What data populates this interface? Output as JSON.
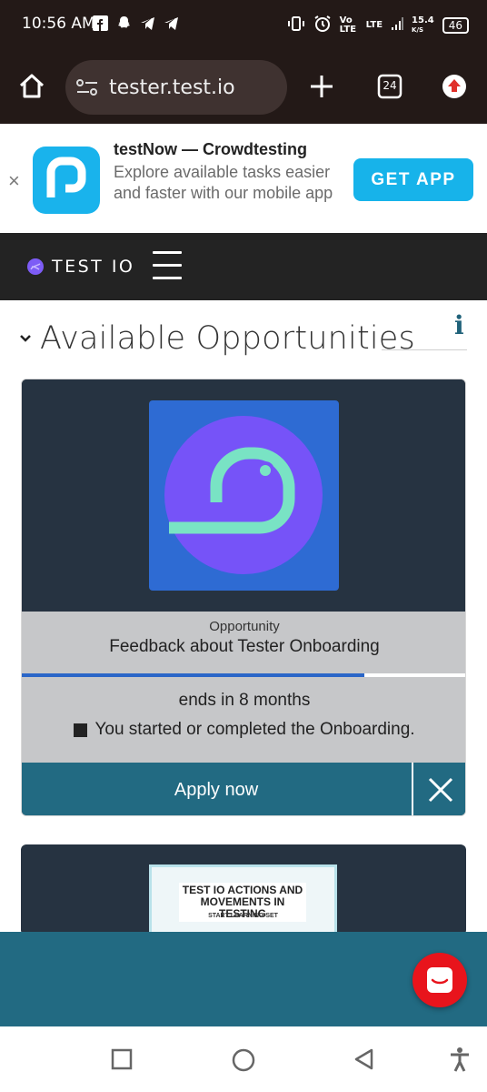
{
  "status_bar": {
    "time": "10:56 AM",
    "network": "Vo LTE",
    "lte": "LTE",
    "speed": "15.4",
    "speed_unit": "K/S",
    "battery": "46"
  },
  "browser": {
    "url": "tester.test.io",
    "tab_count": "24"
  },
  "app_banner": {
    "title": "testNow — Crowdtesting",
    "description": "Explore available tasks easier and faster with our mobile app",
    "cta": "GET APP",
    "close": "×"
  },
  "site_header": {
    "logo_text": "TEST IO"
  },
  "section": {
    "heading": "Available Opportunities",
    "info_glyph": "i"
  },
  "opportunity_card": {
    "type": "Opportunity",
    "title": "Feedback about Tester Onboarding",
    "progress_fraction": 0.77,
    "ends": "ends in 8 months",
    "requirement": "You started or completed the Onboarding.",
    "apply_label": "Apply now"
  },
  "second_card": {
    "thumb_title": "TEST IO ACTIONS AND MOVEMENTS IN TESTING",
    "thumb_subtitle": "START LEARNING SET"
  },
  "colors": {
    "teal": "#226a82",
    "card_dark": "#263341",
    "accent_blue": "#17b3ea",
    "brand_purple": "#7d5cf6",
    "chat_red": "#e8141c"
  },
  "icons": [
    "home-icon",
    "site-settings-icon",
    "plus-icon",
    "tabs-icon",
    "download-icon",
    "close-icon",
    "menu-icon",
    "chevron-down-icon",
    "info-icon",
    "dismiss-icon",
    "chat-icon",
    "recents-icon",
    "home-nav-icon",
    "back-icon",
    "accessibility-icon"
  ]
}
